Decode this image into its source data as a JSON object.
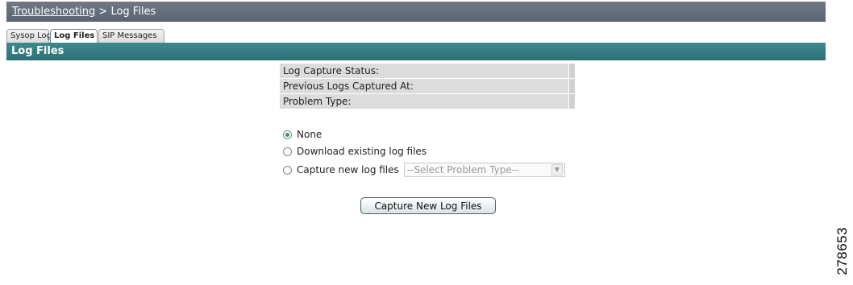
{
  "breadcrumb": {
    "parent": "Troubleshooting",
    "separator": ">",
    "current": "Log Files"
  },
  "tabs": [
    {
      "label": "Sysop Log",
      "active": false
    },
    {
      "label": "Log Files",
      "active": true
    },
    {
      "label": "SIP Messages",
      "active": false
    }
  ],
  "section": {
    "title": "Log Files"
  },
  "status": [
    {
      "label": "Log Capture Status:",
      "value": ""
    },
    {
      "label": "Previous Logs Captured At:",
      "value": ""
    },
    {
      "label": "Problem Type:",
      "value": ""
    }
  ],
  "options": [
    {
      "label": "None",
      "checked": true
    },
    {
      "label": "Download existing log files",
      "checked": false
    },
    {
      "label": "Capture new log files",
      "checked": false
    }
  ],
  "problem_type_select": {
    "selected": "--Select Problem Type--"
  },
  "capture_button": {
    "label": "Capture New Log Files"
  },
  "figure_id": "278653",
  "colors": {
    "breadcrumb_bg": "#5f6975",
    "section_header_bg": "#2f7479",
    "radio_selected": "#2d9b4a"
  },
  "icons": {
    "dropdown": "chevron-down-icon"
  }
}
